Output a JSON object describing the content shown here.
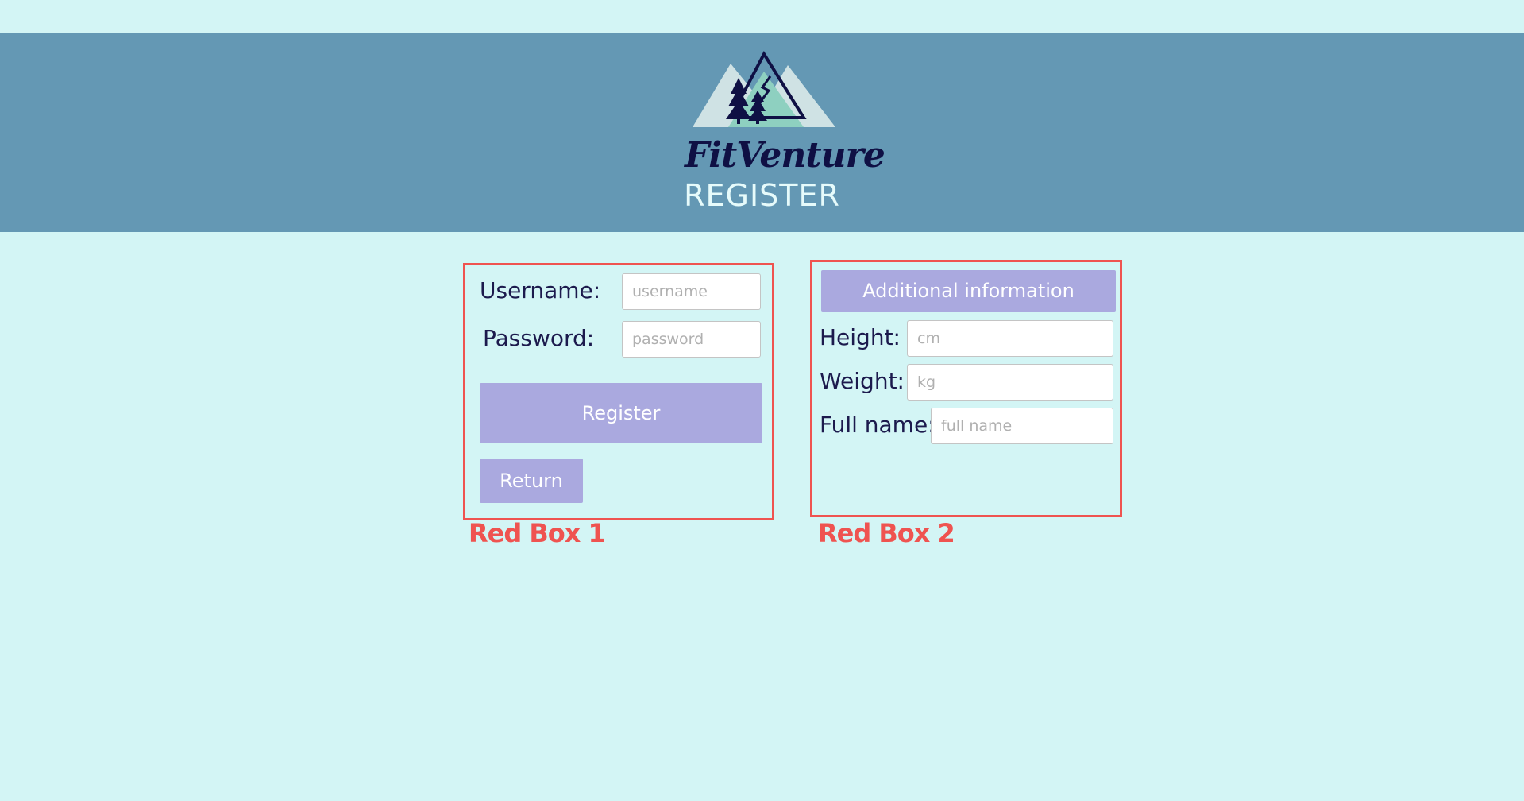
{
  "header": {
    "brand": "FitVenture",
    "title": "REGISTER",
    "logo_icon": "mountain-trees-logo",
    "color": "#6498b4"
  },
  "login_form": {
    "username_label": "Username:",
    "username_placeholder": "username",
    "password_label": "Password:",
    "password_placeholder": "password",
    "register_button": "Register",
    "return_button": "Return"
  },
  "additional_form": {
    "header_button": "Additional information",
    "height_label": "Height:",
    "height_placeholder": "cm",
    "weight_label": "Weight:",
    "weight_placeholder": "kg",
    "fullname_label": "Full name:",
    "fullname_placeholder": "full name"
  },
  "annotations": {
    "box1_label": "Red Box 1",
    "box2_label": "Red Box 2",
    "color": "#ef5350"
  },
  "colors": {
    "background": "#d3f5f5",
    "button": "#aaa9df",
    "text": "#1c1a4d"
  }
}
